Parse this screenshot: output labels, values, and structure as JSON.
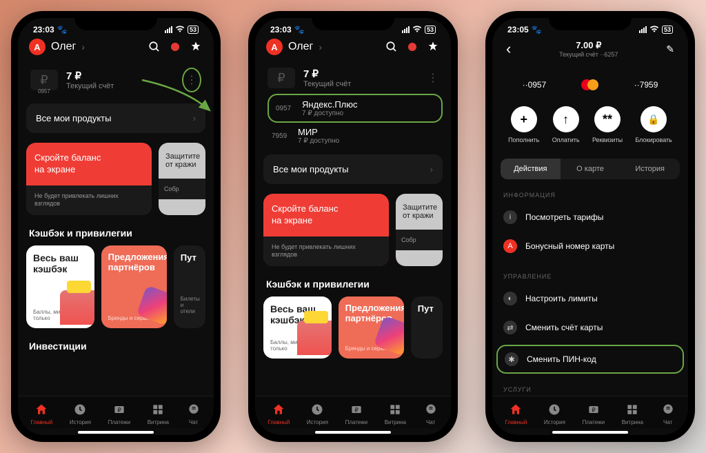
{
  "status": {
    "time1": "23:03",
    "time2": "23:03",
    "time3": "23:05",
    "paw": "🐾",
    "battery": "53"
  },
  "header": {
    "name": "Олег",
    "icons": {
      "search": "search",
      "notify": "notify"
    }
  },
  "balance": {
    "amount": "7 ₽",
    "label": "Текущий счёт",
    "mask": "0957"
  },
  "cards": [
    {
      "mask": "0957",
      "name": "Яндекс.Плюс",
      "avail": "7 ₽ доступно"
    },
    {
      "mask": "7959",
      "name": "МИР",
      "avail": "7 ₽ доступно"
    }
  ],
  "all_products": "Все мои продукты",
  "promo": {
    "hide_l1": "Скройте баланс",
    "hide_l2": "на экране",
    "hide_foot": "Не будет привлекать лишних взглядов",
    "protect_l1": "Защитите",
    "protect_l2": "от кражи",
    "protect_foot": "Собр"
  },
  "cashback": {
    "title": "Кэшбэк и привилегии",
    "t1_title": "Весь ваш кэшбэк",
    "t1_sub": "Баллы, мили и не только",
    "t2_title": "Предложения партнёров",
    "t2_sub": "Бренды и сервисы",
    "t3_title": "Пут",
    "t3_sub": "Билеты и отели"
  },
  "investments": "Инвестиции",
  "p3": {
    "amount": "7.00 ₽",
    "sub": "Текущий счёт ··6257",
    "acct1": "··0957",
    "acct2": "··7959",
    "actions": [
      "Пополнить",
      "Оплатить",
      "Реквизиты",
      "Блокировать"
    ],
    "tabs": [
      "Действия",
      "О карте",
      "История"
    ],
    "grp_info": "ИНФОРМАЦИЯ",
    "row_tarif": "Посмотреть тарифы",
    "row_bonus": "Бонусный номер карты",
    "grp_manage": "УПРАВЛЕНИЕ",
    "row_limits": "Настроить лимиты",
    "row_swap": "Сменить счёт карты",
    "row_pin": "Сменить ПИН-код",
    "grp_svc": "УСЛУГИ"
  },
  "tabs": [
    "Главный",
    "История",
    "Платежи",
    "Витрина",
    "Чат"
  ]
}
